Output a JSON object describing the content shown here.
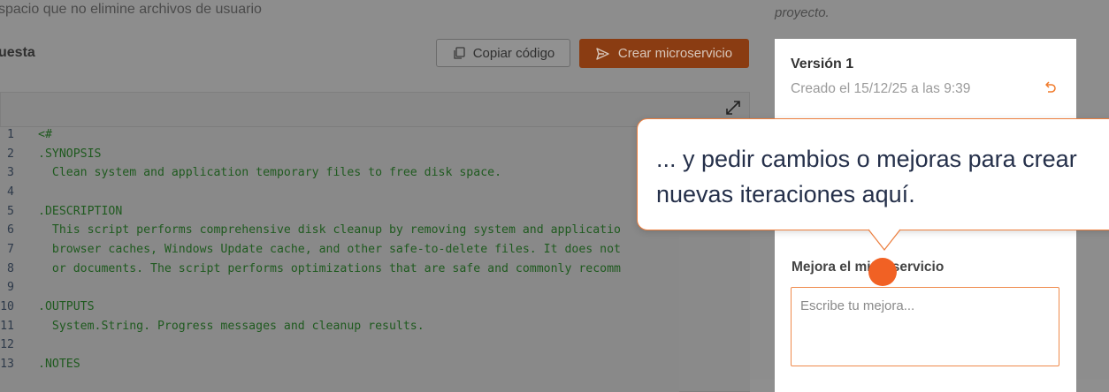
{
  "context": {
    "description": "spacio que no elimine archivos de usuario",
    "right_note": "proyecto."
  },
  "header": {
    "section_title": "uesta",
    "copy_label": "Copiar código",
    "create_label": "Crear microservicio"
  },
  "code": {
    "lines": [
      {
        "n": "1",
        "text": "<#"
      },
      {
        "n": "2",
        "text": ".SYNOPSIS"
      },
      {
        "n": "3",
        "text": "  Clean system and application temporary files to free disk space."
      },
      {
        "n": "4",
        "text": ""
      },
      {
        "n": "5",
        "text": ".DESCRIPTION"
      },
      {
        "n": "6",
        "text": "  This script performs comprehensive disk cleanup by removing system and applicatio"
      },
      {
        "n": "7",
        "text": "  browser caches, Windows Update cache, and other safe-to-delete files. It does not"
      },
      {
        "n": "8",
        "text": "  or documents. The script performs optimizations that are safe and commonly recomm"
      },
      {
        "n": "9",
        "text": ""
      },
      {
        "n": "10",
        "text": ".OUTPUTS"
      },
      {
        "n": "11",
        "text": "  System.String. Progress messages and cleanup results."
      },
      {
        "n": "12",
        "text": ""
      },
      {
        "n": "13",
        "text": ".NOTES"
      }
    ]
  },
  "sidebar": {
    "version_title": "Versión 1",
    "version_date": "Creado el 15/12/25 a las 9:39",
    "improve_label": "Mejora el microservicio",
    "improve_placeholder": "Escribe tu mejora..."
  },
  "callout": {
    "text": "... y pedir cambios o mejoras para crear nuevas iteraciones aquí."
  },
  "colors": {
    "accent": "#f16124",
    "create_button_dimmed": "#8a3c12",
    "overlay_gray": "#8d8d8d",
    "code_green": "#1f5a1f"
  },
  "icons": {
    "copy": "copy-icon",
    "send": "send-icon",
    "expand": "expand-icon",
    "restore": "undo-icon"
  }
}
